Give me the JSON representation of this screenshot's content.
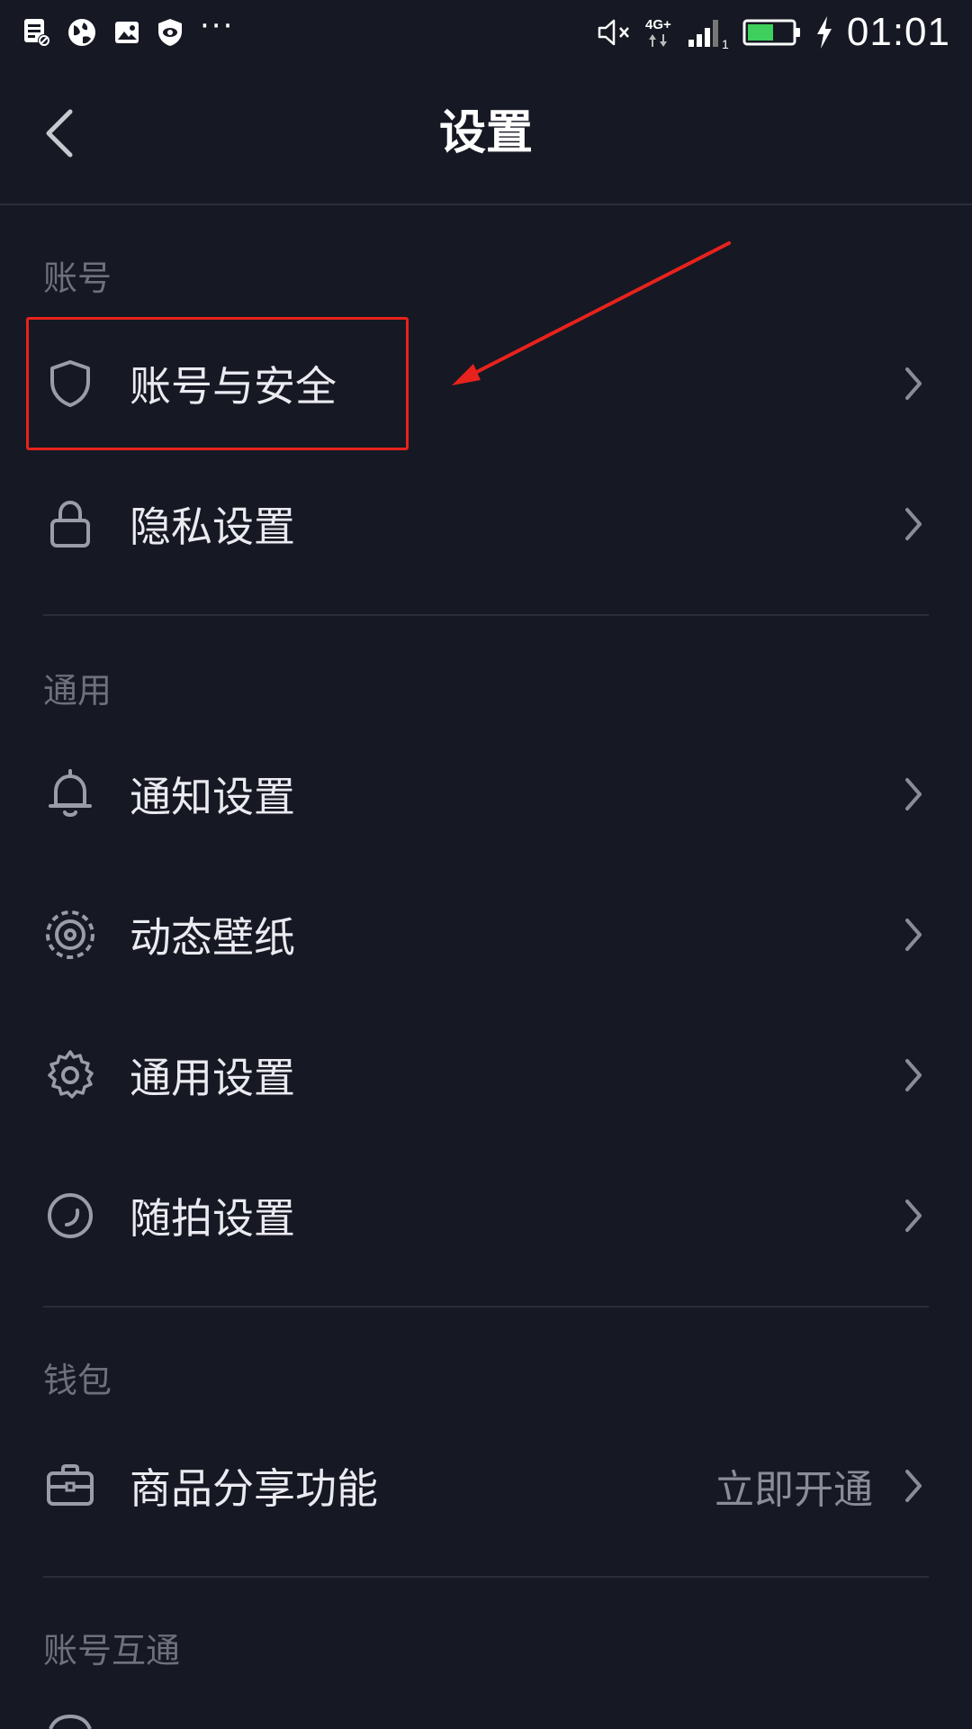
{
  "status_bar": {
    "time": "01:01",
    "network": "4G+",
    "sim_slot": "1",
    "more": "···",
    "icons": [
      "message-icon",
      "globe-icon",
      "image-icon",
      "shield-eye-icon",
      "mute-icon",
      "signal-icon",
      "battery-icon",
      "charging-icon"
    ]
  },
  "header": {
    "title": "设置"
  },
  "sections": [
    {
      "label": "账号",
      "items": [
        {
          "label": "账号与安全",
          "icon": "shield-icon"
        },
        {
          "label": "隐私设置",
          "icon": "lock-icon"
        }
      ]
    },
    {
      "label": "通用",
      "items": [
        {
          "label": "通知设置",
          "icon": "bell-icon"
        },
        {
          "label": "动态壁纸",
          "icon": "live-wallpaper-icon"
        },
        {
          "label": "通用设置",
          "icon": "gear-icon"
        },
        {
          "label": "随拍设置",
          "icon": "camera-shot-icon"
        }
      ]
    },
    {
      "label": "钱包",
      "items": [
        {
          "label": "商品分享功能",
          "icon": "briefcase-icon",
          "value": "立即开通"
        }
      ]
    },
    {
      "label": "账号互通",
      "items": []
    }
  ],
  "colors": {
    "background": "#161823",
    "annotation": "#e8221c",
    "section_label": "#6e707c",
    "battery_fill": "#3ecf5c"
  }
}
